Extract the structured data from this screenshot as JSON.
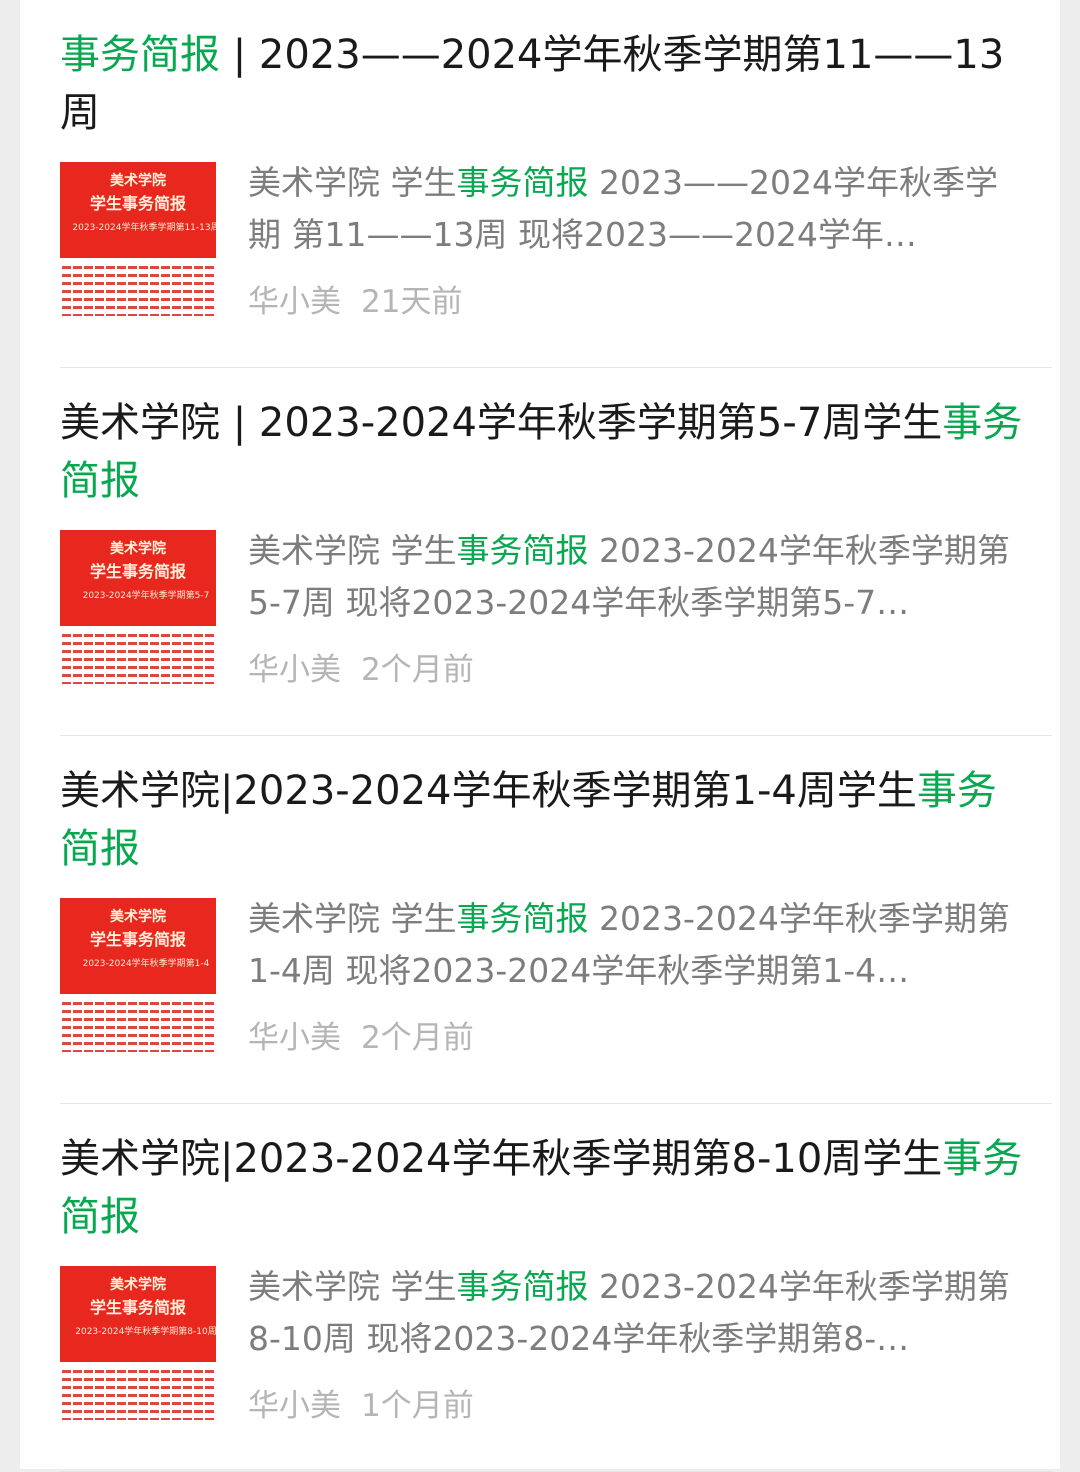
{
  "items": [
    {
      "title_lead": "",
      "title_hl": "事务简报",
      "title_tail": " | 2023——2024学年秋季学期第11——13周",
      "thumb": {
        "line1": "美术学院",
        "line2": "学生事务简报",
        "line3": "2023-2024学年秋季学期第11-13周"
      },
      "summary_pre": "美术学院 学生",
      "summary_hl": "事务简报",
      "summary_post": " 2023——2024学年秋季学期 第11——13周 现将2023——2024学年…",
      "author": "华小美",
      "time": "21天前"
    },
    {
      "title_lead": "美术学院 | 2023-2024学年秋季学期第5-7周学生",
      "title_hl": "事务简报",
      "title_tail": "",
      "thumb": {
        "line1": "美术学院",
        "line2": "学生事务简报",
        "line3": "2023-2024学年秋季学期第5-7"
      },
      "summary_pre": "美术学院 学生",
      "summary_hl": "事务简报",
      "summary_post": " 2023-2024学年秋季学期第5-7周 现将2023-2024学年秋季学期第5-7…",
      "author": "华小美",
      "time": "2个月前"
    },
    {
      "title_lead": "美术学院|2023-2024学年秋季学期第1-4周学生",
      "title_hl": "事务简报",
      "title_tail": "",
      "thumb": {
        "line1": "美术学院",
        "line2": "学生事务简报",
        "line3": "2023-2024学年秋季学期第1-4"
      },
      "summary_pre": "美术学院 学生",
      "summary_hl": "事务简报",
      "summary_post": " 2023-2024学年秋季学期第1-4周 现将2023-2024学年秋季学期第1-4…",
      "author": "华小美",
      "time": "2个月前"
    },
    {
      "title_lead": "美术学院|2023-2024学年秋季学期第8-10周学生",
      "title_hl": "事务简报",
      "title_tail": "",
      "thumb": {
        "line1": "美术学院",
        "line2": "学生事务简报",
        "line3": "2023-2024学年秋季学期第8-10周"
      },
      "summary_pre": "美术学院 学生",
      "summary_hl": "事务简报",
      "summary_post": " 2023-2024学年秋季学期第8-10周 现将2023-2024学年秋季学期第8-…",
      "author": "华小美",
      "time": "1个月前"
    }
  ],
  "colors": {
    "highlight": "#07a84f",
    "thumb_red": "#e8271f",
    "meta_gray": "#b5b5b5"
  }
}
